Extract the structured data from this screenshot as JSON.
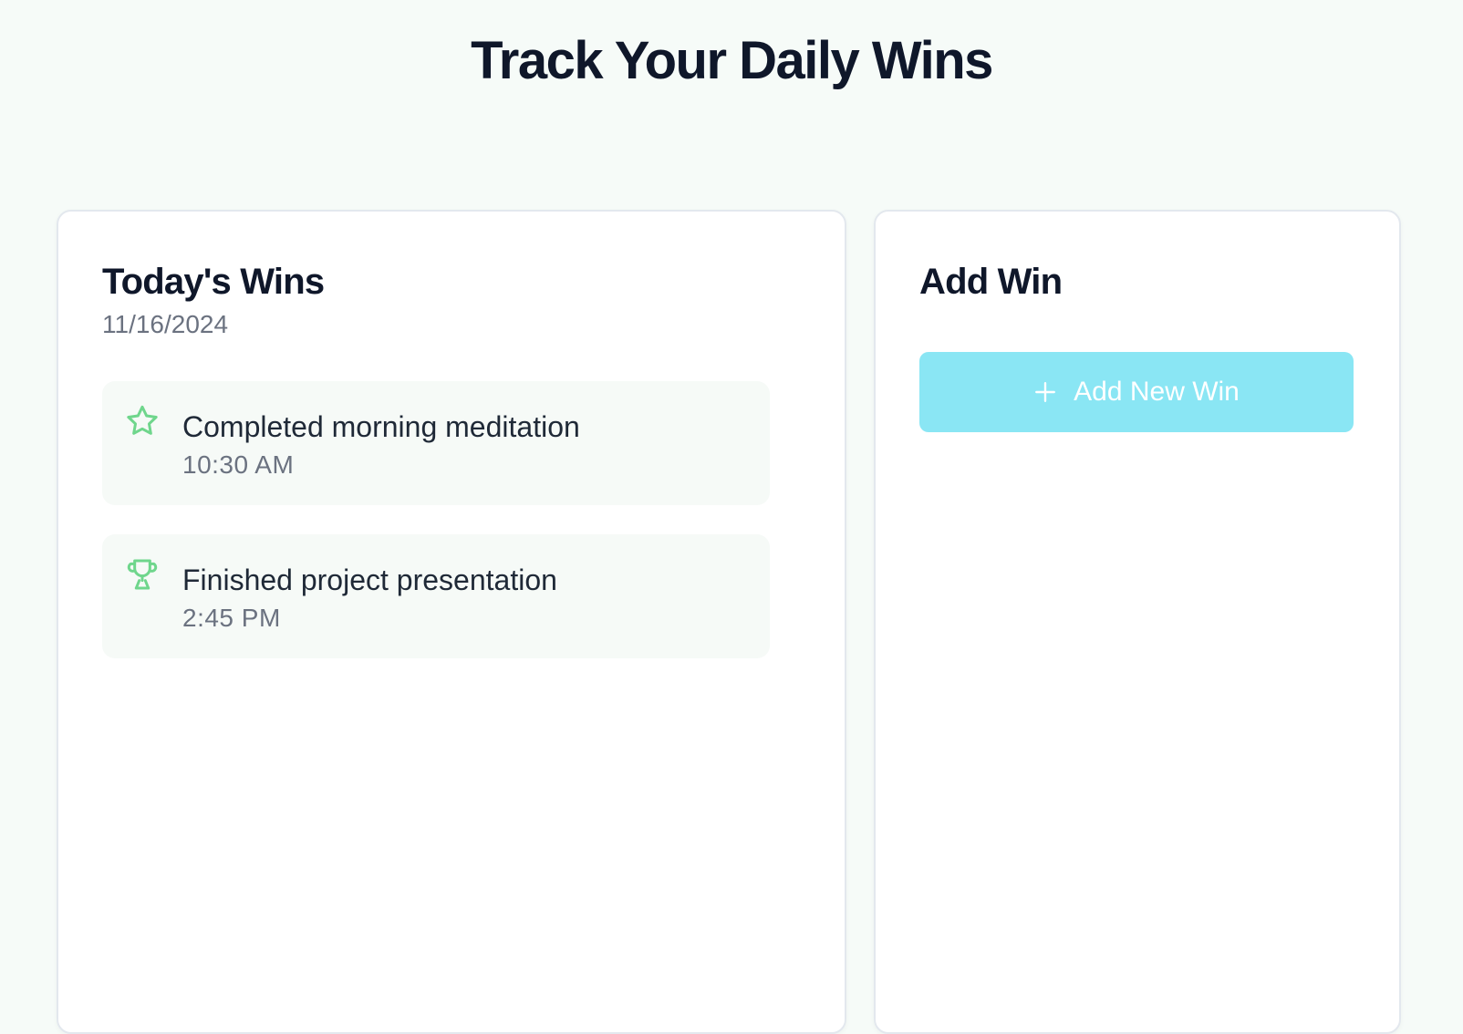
{
  "header": {
    "title": "Track Your Daily Wins"
  },
  "wins_panel": {
    "title": "Today's Wins",
    "date": "11/16/2024",
    "items": [
      {
        "icon": "star-icon",
        "text": "Completed morning meditation",
        "time": "10:30 AM"
      },
      {
        "icon": "trophy-icon",
        "text": "Finished project presentation",
        "time": "2:45 PM"
      }
    ]
  },
  "add_panel": {
    "title": "Add Win",
    "button_label": "Add New Win",
    "button_icon": "plus-icon"
  },
  "colors": {
    "background": "#f6fbf8",
    "icon_green": "#6fd68c",
    "button_cyan": "#8ae6f4",
    "text_dark": "#0f172a",
    "text_muted": "#6b7280"
  }
}
